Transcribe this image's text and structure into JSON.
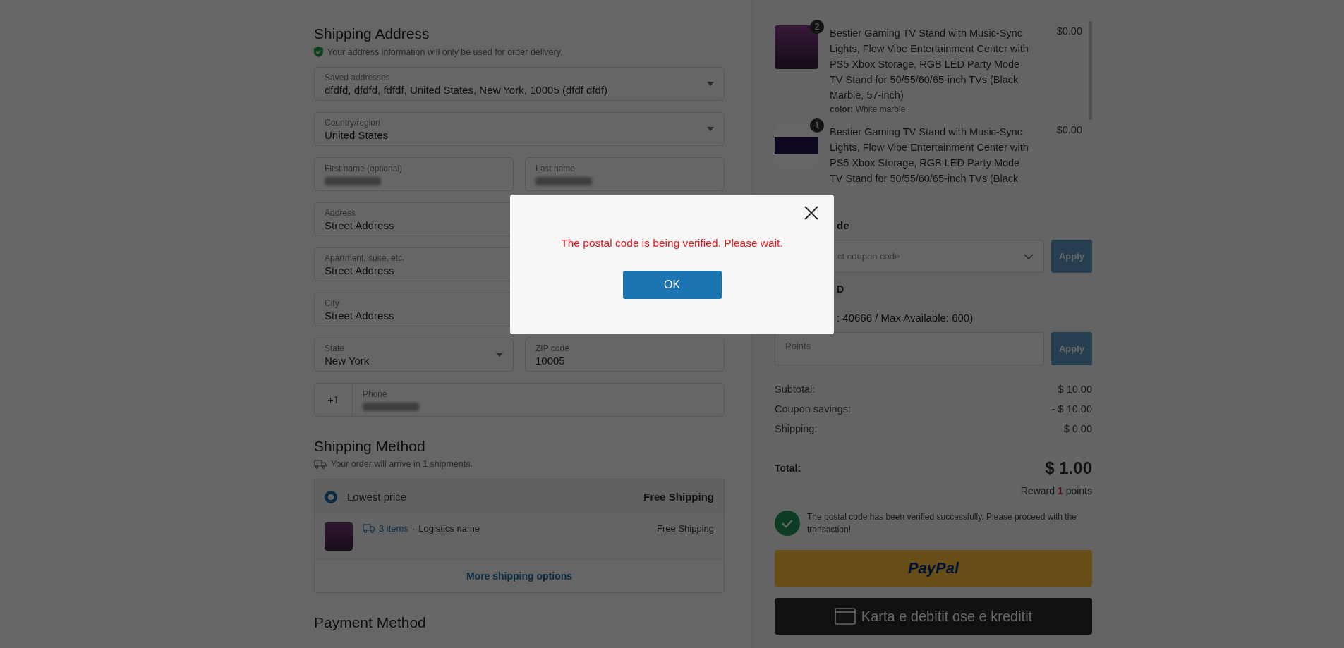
{
  "shipping_address": {
    "title": "Shipping Address",
    "note": "Your address information will only be used for order delivery.",
    "rows": [
      [
        {
          "kind": "select",
          "label": "Saved addresses",
          "value": "dfdfd, dfdfd, fdfdf, United States, New York, 10005 (dfdf dfdf)"
        }
      ],
      [
        {
          "kind": "select",
          "label": "Country/region",
          "value": "United States"
        }
      ],
      [
        {
          "kind": "redacted",
          "label": "First name (optional)"
        },
        {
          "kind": "redacted",
          "label": "Last name"
        }
      ],
      [
        {
          "kind": "text",
          "label": "Address",
          "value": "Street Address"
        }
      ],
      [
        {
          "kind": "text",
          "label": "Apartment, suite, etc.",
          "value": "Street Address"
        }
      ],
      [
        {
          "kind": "text",
          "label": "City",
          "value": "Street Address"
        }
      ],
      [
        {
          "kind": "select",
          "label": "State",
          "value": "New York"
        },
        {
          "kind": "text",
          "label": "ZIP code",
          "value": "10005"
        }
      ],
      [
        {
          "kind": "phone",
          "prefix": "+1",
          "label": "Phone"
        }
      ]
    ]
  },
  "shipping_method": {
    "title": "Shipping Method",
    "note": "Your order will arrive in 1 shipments.",
    "option": {
      "label": "Lowest price",
      "price": "Free Shipping",
      "selected": true
    },
    "shipment": {
      "items": "3 items",
      "separator": "·",
      "carrier": "Logistics name",
      "price": "Free Shipping"
    },
    "more": "More shipping options"
  },
  "payment_method": {
    "title": "Payment Method"
  },
  "order_items": [
    {
      "quantity": "2",
      "title": "Bestier Gaming TV Stand with Music-Sync Lights, Flow Vibe Entertainment Center with PS5 Xbox Storage, RGB LED Party Mode TV Stand for 50/55/60/65-inch TVs (Black Marble, 57-inch)",
      "price": "$0.00",
      "color_label": "color:",
      "color_value": "White marble"
    },
    {
      "quantity": "1",
      "title": "Bestier Gaming TV Stand with Music-Sync Lights, Flow Vibe Entertainment Center with PS5 Xbox Storage, RGB LED Party Mode TV Stand for 50/55/60/65-inch TVs (Black",
      "price": "$0.00"
    }
  ],
  "coupon": {
    "heading": "de",
    "placeholder": "ct coupon code",
    "apply": "Apply",
    "tag": "D"
  },
  "points": {
    "label": ": 40666 / Max Available: 600)",
    "placeholder": "Points",
    "apply": "Apply"
  },
  "totals": [
    {
      "label": "Subtotal:",
      "value": "$ 10.00"
    },
    {
      "label": "Coupon savings:",
      "value": "- $ 10.00"
    },
    {
      "label": "Shipping:",
      "value": "$ 0.00"
    }
  ],
  "total": {
    "label": "Total:",
    "value": "$ 1.00"
  },
  "reward": {
    "prefix": "Reward",
    "value": "1",
    "suffix": "points"
  },
  "verified": "The postal code has been verified successfully. Please proceed with the transaction!",
  "paypal": "PayPal",
  "card_button": "Karta e debitit ose e kreditit",
  "modal": {
    "message": "The postal code is being verified. Please wait.",
    "ok": "OK"
  }
}
